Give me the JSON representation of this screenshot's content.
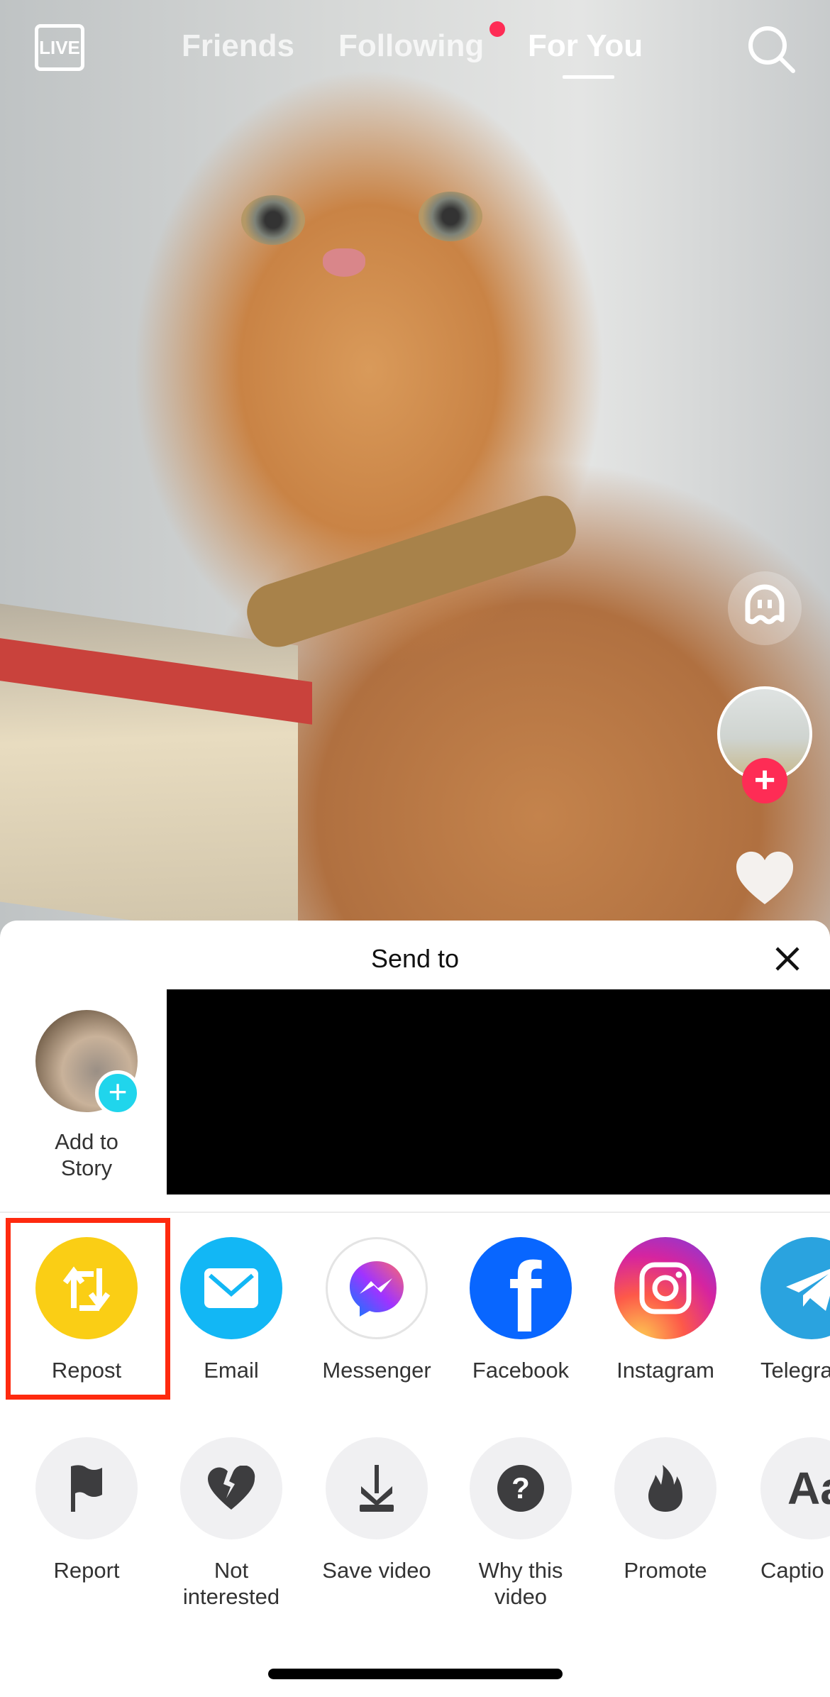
{
  "top_nav": {
    "live_label": "LIVE",
    "tabs": [
      {
        "label": "Friends"
      },
      {
        "label": "Following",
        "has_notification_dot": true
      },
      {
        "label": "For You",
        "active": true
      }
    ],
    "search_icon": "search-icon"
  },
  "sidebar": {
    "avatar_follow_icon": "plus-icon",
    "like_icon": "heart-icon",
    "effect_icon": "ghost-icon"
  },
  "sheet": {
    "title": "Send to",
    "close_icon": "close-icon",
    "story": {
      "label_line1": "Add to",
      "label_line2": "Story"
    },
    "share_row": [
      {
        "label": "Repost",
        "icon": "repost-icon",
        "color": "#face15",
        "highlighted": true
      },
      {
        "label": "Email",
        "icon": "email-icon",
        "color": "#12b7f5"
      },
      {
        "label": "Messenger",
        "icon": "messenger-icon",
        "color": "#ffffff"
      },
      {
        "label": "Facebook",
        "icon": "facebook-icon",
        "color": "#0866ff"
      },
      {
        "label": "Instagram",
        "icon": "instagram-icon",
        "color": "#d62976"
      },
      {
        "label": "Telegra",
        "icon": "telegram-icon",
        "color": "#2aa3df"
      }
    ],
    "action_row": [
      {
        "label": "Report",
        "icon": "flag-icon"
      },
      {
        "label_line1": "Not",
        "label_line2": "interested",
        "icon": "broken-heart-icon"
      },
      {
        "label": "Save video",
        "icon": "download-icon"
      },
      {
        "label_line1": "Why this",
        "label_line2": "video",
        "icon": "question-icon"
      },
      {
        "label": "Promote",
        "icon": "flame-icon"
      },
      {
        "label": "Captio",
        "icon": "text-aa-icon",
        "glyph": "Aa"
      }
    ]
  }
}
